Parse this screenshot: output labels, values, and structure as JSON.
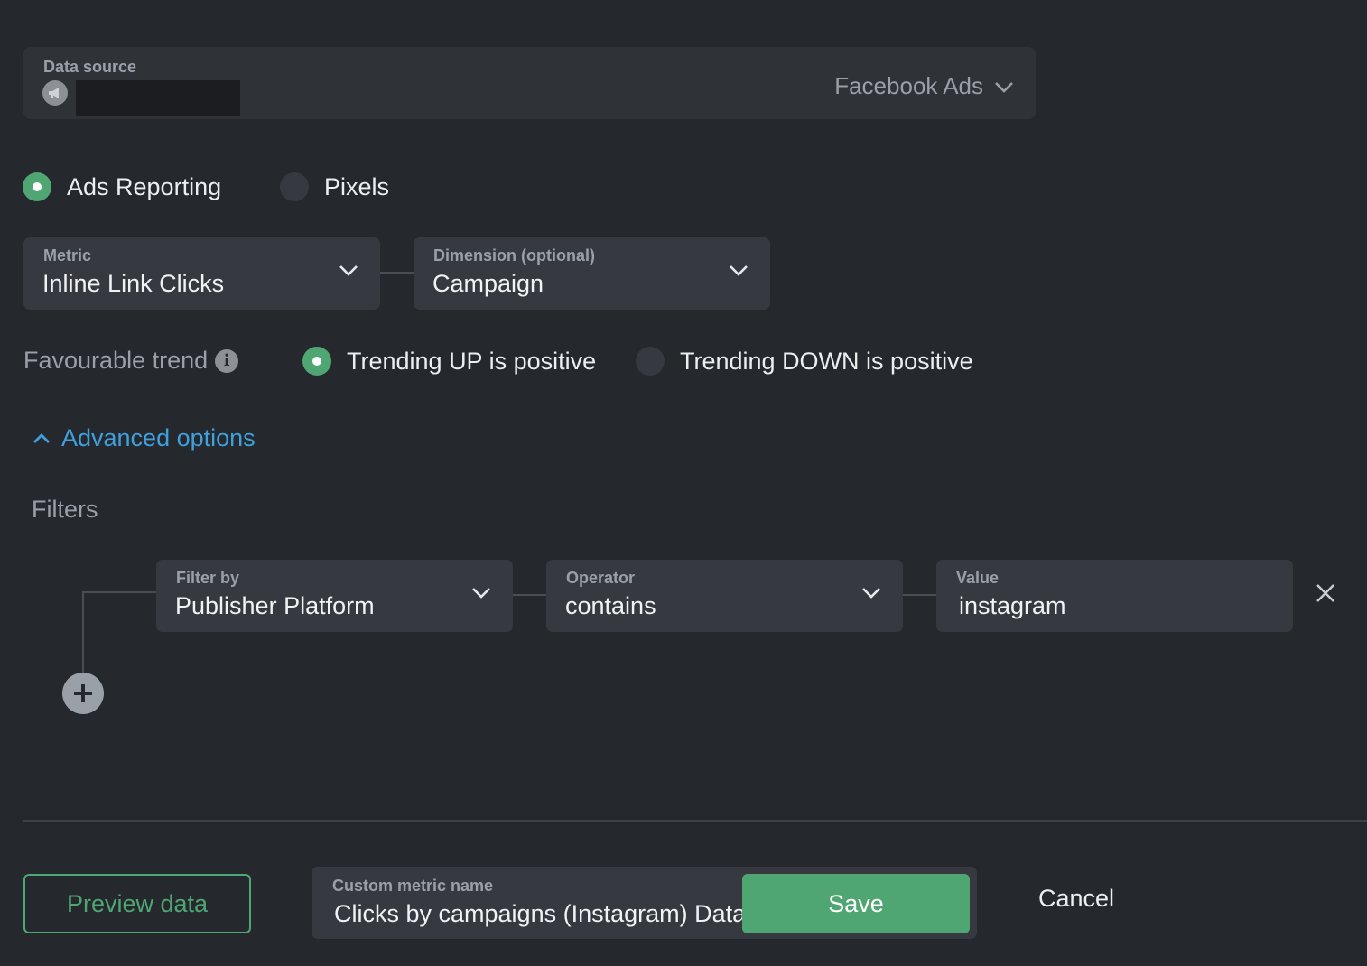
{
  "data_source": {
    "label": "Data source",
    "selected": "Facebook Ads",
    "icon": "megaphone-icon"
  },
  "report_type": {
    "options": [
      "Ads Reporting",
      "Pixels"
    ],
    "selected": "Ads Reporting"
  },
  "metric": {
    "label": "Metric",
    "value": "Inline Link Clicks"
  },
  "dimension": {
    "label": "Dimension (optional)",
    "value": "Campaign"
  },
  "trend": {
    "label": "Favourable trend",
    "options": [
      "Trending UP is positive",
      "Trending DOWN is positive"
    ],
    "selected": "Trending UP is positive"
  },
  "advanced": {
    "label": "Advanced options",
    "expanded": true
  },
  "filters": {
    "title": "Filters",
    "rows": [
      {
        "filter_by_label": "Filter by",
        "filter_by": "Publisher Platform",
        "operator_label": "Operator",
        "operator": "contains",
        "value_label": "Value",
        "value": "instagram"
      }
    ]
  },
  "footer": {
    "preview_label": "Preview data",
    "name_label": "Custom metric name",
    "name_value": "Clicks by campaigns (Instagram) Databox",
    "save_label": "Save",
    "cancel_label": "Cancel"
  },
  "colors": {
    "background": "#25282d",
    "accent_green": "#4fa672",
    "link_blue": "#3fa0dc"
  }
}
